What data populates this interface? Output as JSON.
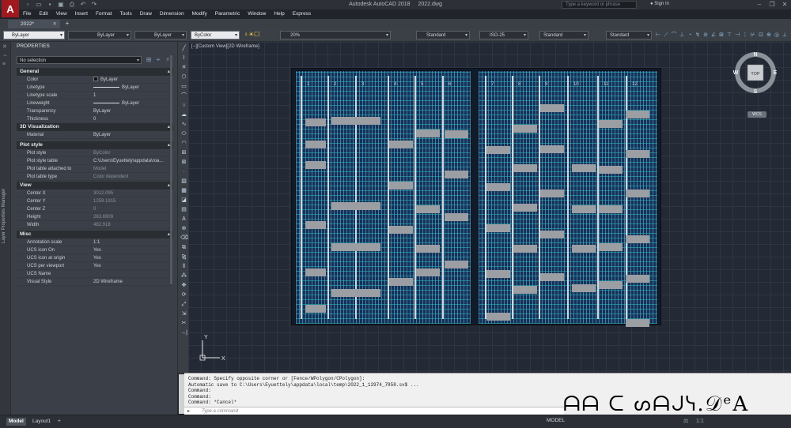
{
  "app": {
    "name": "Autodesk AutoCAD 2018",
    "file": "2022.dwg",
    "logo": "A"
  },
  "search": {
    "placeholder": "Type a keyword or phrase"
  },
  "account": {
    "signin": "Sign In"
  },
  "menu": [
    "File",
    "Edit",
    "View",
    "Insert",
    "Format",
    "Tools",
    "Draw",
    "Dimension",
    "Modify",
    "Parametric",
    "Window",
    "Help",
    "Express"
  ],
  "tabs": {
    "doc": "2022*",
    "new": "+"
  },
  "ribbon": {
    "layer": "ByLayer",
    "linetype": "ByLayer",
    "lineweight": "ByLayer",
    "color": "ByColor",
    "transparency": "20%",
    "textstyle": "Standard",
    "dimstyle": "ISO-25",
    "tablestyle": "Standard",
    "mleaderstyle": "Standard"
  },
  "palette": {
    "side_label": "Layer Properties Manager",
    "title": "PROPERTIES",
    "selection": "No selection",
    "sections": {
      "general": {
        "title": "General",
        "rows": [
          {
            "k": "Color",
            "v": "ByLayer"
          },
          {
            "k": "Linetype",
            "v": "ByLayer"
          },
          {
            "k": "Linetype scale",
            "v": "1"
          },
          {
            "k": "Lineweight",
            "v": "ByLayer"
          },
          {
            "k": "Transparency",
            "v": "ByLayer"
          },
          {
            "k": "Thickness",
            "v": "0"
          }
        ]
      },
      "viz": {
        "title": "3D Visualization",
        "rows": [
          {
            "k": "Material",
            "v": "ByLayer"
          }
        ]
      },
      "plot": {
        "title": "Plot style",
        "rows": [
          {
            "k": "Plot style",
            "v": "ByColor"
          },
          {
            "k": "Plot style table",
            "v": "C:\\Users\\Eyuettely\\appdata\\roa..."
          },
          {
            "k": "Plot table attached to",
            "v": "Model"
          },
          {
            "k": "Plot table type",
            "v": "Color dependent"
          }
        ]
      },
      "view": {
        "title": "View",
        "rows": [
          {
            "k": "Center X",
            "v": "3012.095"
          },
          {
            "k": "Center Y",
            "v": "1259.1915"
          },
          {
            "k": "Center Z",
            "v": "0"
          },
          {
            "k": "Height",
            "v": "263.6909"
          },
          {
            "k": "Width",
            "v": "482.918"
          }
        ]
      },
      "misc": {
        "title": "Misc",
        "rows": [
          {
            "k": "Annotation scale",
            "v": "1:1"
          },
          {
            "k": "UCS icon On",
            "v": "Yes"
          },
          {
            "k": "UCS icon at origin",
            "v": "Yes"
          },
          {
            "k": "UCS per viewport",
            "v": "Yes"
          },
          {
            "k": "UCS Name",
            "v": ""
          },
          {
            "k": "Visual Style",
            "v": "2D Wireframe"
          }
        ]
      }
    }
  },
  "viewport": {
    "label": "[−][Custom View][2D Wireframe]",
    "viewcube": {
      "n": "N",
      "s": "S",
      "e": "E",
      "w": "W",
      "face": "TOP",
      "wcs": "WCS"
    },
    "ucs": {
      "x": "X",
      "y": "Y"
    },
    "columns_left": [
      "1",
      "2",
      "3",
      "4",
      "5",
      "6"
    ],
    "columns_right": [
      "7",
      "8",
      "9",
      "10",
      "11",
      "12"
    ]
  },
  "command": {
    "lines": [
      "Command: Specify opposite corner or [Fence/WPolygon/CPolygon]:",
      "Automatic save to C:\\Users\\Eyuettely\\appdata\\local\\temp\\2022_1_12974_7858.sv$ ...",
      "Command:",
      "Command:",
      "Command: *Cancel*"
    ],
    "placeholder": "Type a command"
  },
  "status": {
    "tabs": [
      "Model",
      "Layout1"
    ],
    "add": "+",
    "model": "MODEL",
    "scale": "1:1"
  },
  "watermark": "ᗩᗩ ᑕ ᔕᗩᒍᓭ.𝒟ᵉA"
}
